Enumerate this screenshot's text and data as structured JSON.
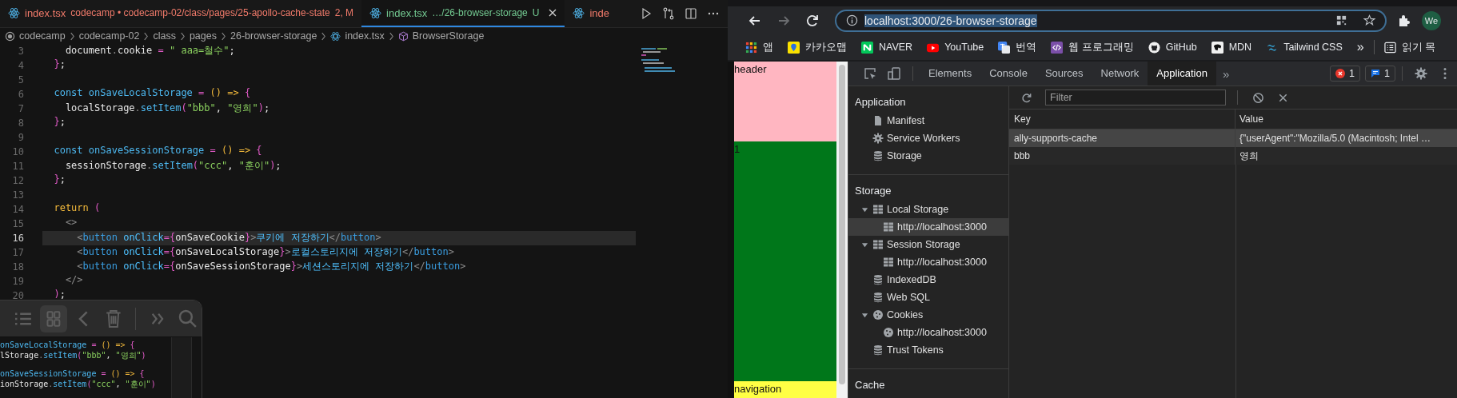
{
  "editor": {
    "tabs": [
      {
        "filename": "index.tsx",
        "path": "codecamp • codecamp-02/class/pages/25-apollo-cache-state",
        "status": "2, M",
        "kind": "modified",
        "selected": false
      },
      {
        "filename": "index.tsx",
        "path": "…/26-browser-storage",
        "status": "U",
        "kind": "untracked",
        "selected": true
      },
      {
        "filename": "inde",
        "kind": "modified",
        "selected": false
      }
    ],
    "breadcrumbs": [
      {
        "label": "codecamp",
        "kind": "folder"
      },
      {
        "label": "codecamp-02",
        "kind": "folder"
      },
      {
        "label": "class",
        "kind": "folder"
      },
      {
        "label": "pages",
        "kind": "folder"
      },
      {
        "label": "26-browser-storage",
        "kind": "folder"
      },
      {
        "label": "index.tsx",
        "kind": "file"
      },
      {
        "label": "BrowserStorage",
        "kind": "symbol"
      }
    ],
    "lines": [
      {
        "number": "3",
        "current": false,
        "tokens": [
          {
            "text": "    document",
            "kind": "plain"
          },
          {
            "text": ".",
            "kind": "punct"
          },
          {
            "text": "cookie ",
            "kind": "plain"
          },
          {
            "text": "= ",
            "kind": "op"
          },
          {
            "text": "\" aaa=철수\"",
            "kind": "str"
          },
          {
            "text": ";",
            "kind": "plain"
          }
        ]
      },
      {
        "number": "4",
        "current": false,
        "tokens": [
          {
            "text": "  }",
            "kind": "op"
          },
          {
            "text": ";",
            "kind": "plain"
          }
        ]
      },
      {
        "number": "5",
        "current": false
      },
      {
        "number": "6",
        "current": false,
        "tokens": [
          {
            "text": "  const ",
            "kind": "kw"
          },
          {
            "text": "onSaveLocalStorage ",
            "kind": "fn"
          },
          {
            "text": "= ",
            "kind": "op"
          },
          {
            "text": "() ",
            "kind": "yellow"
          },
          {
            "text": "=> ",
            "kind": "yellow"
          },
          {
            "text": "{",
            "kind": "op"
          }
        ]
      },
      {
        "number": "7",
        "current": false,
        "tokens": [
          {
            "text": "    localStorage",
            "kind": "plain"
          },
          {
            "text": ".",
            "kind": "punct"
          },
          {
            "text": "setItem",
            "kind": "fn"
          },
          {
            "text": "(",
            "kind": "op"
          },
          {
            "text": "\"bbb\"",
            "kind": "str"
          },
          {
            "text": ", ",
            "kind": "plain"
          },
          {
            "text": "\"영희\"",
            "kind": "str"
          },
          {
            "text": ")",
            "kind": "op"
          },
          {
            "text": ";",
            "kind": "plain"
          }
        ]
      },
      {
        "number": "8",
        "current": false,
        "tokens": [
          {
            "text": "  }",
            "kind": "op"
          },
          {
            "text": ";",
            "kind": "plain"
          }
        ]
      },
      {
        "number": "9",
        "current": false
      },
      {
        "number": "10",
        "current": false,
        "tokens": [
          {
            "text": "  const ",
            "kind": "kw"
          },
          {
            "text": "onSaveSessionStorage ",
            "kind": "fn"
          },
          {
            "text": "= ",
            "kind": "op"
          },
          {
            "text": "() ",
            "kind": "yellow"
          },
          {
            "text": "=> ",
            "kind": "yellow"
          },
          {
            "text": "{",
            "kind": "op"
          }
        ]
      },
      {
        "number": "11",
        "current": false,
        "tokens": [
          {
            "text": "    sessionStorage",
            "kind": "plain"
          },
          {
            "text": ".",
            "kind": "punct"
          },
          {
            "text": "setItem",
            "kind": "fn"
          },
          {
            "text": "(",
            "kind": "op"
          },
          {
            "text": "\"ccc\"",
            "kind": "str"
          },
          {
            "text": ", ",
            "kind": "plain"
          },
          {
            "text": "\"훈이\"",
            "kind": "str"
          },
          {
            "text": ")",
            "kind": "op"
          },
          {
            "text": ";",
            "kind": "plain"
          }
        ]
      },
      {
        "number": "12",
        "current": false,
        "tokens": [
          {
            "text": "  }",
            "kind": "op"
          },
          {
            "text": ";",
            "kind": "plain"
          }
        ]
      },
      {
        "number": "13",
        "current": false
      },
      {
        "number": "14",
        "current": false,
        "tokens": [
          {
            "text": "  return ",
            "kind": "yellow"
          },
          {
            "text": "(",
            "kind": "op"
          }
        ]
      },
      {
        "number": "15",
        "current": false,
        "tokens": [
          {
            "text": "    <>",
            "kind": "punct"
          }
        ]
      },
      {
        "number": "16",
        "current": true,
        "tokens": [
          {
            "text": "      <",
            "kind": "punct"
          },
          {
            "text": "button ",
            "kind": "tag"
          },
          {
            "text": "onClick",
            "kind": "attr"
          },
          {
            "text": "={",
            "kind": "op"
          },
          {
            "text": "onSaveCookie",
            "kind": "plain"
          },
          {
            "text": "}",
            "kind": "op"
          },
          {
            "text": ">",
            "kind": "punct"
          },
          {
            "text": "쿠키에 저장하기",
            "kind": "text"
          },
          {
            "text": "</",
            "kind": "punct"
          },
          {
            "text": "button",
            "kind": "tag"
          },
          {
            "text": ">",
            "kind": "punct"
          }
        ]
      },
      {
        "number": "17",
        "current": false,
        "tokens": [
          {
            "text": "      <",
            "kind": "punct"
          },
          {
            "text": "button ",
            "kind": "tag"
          },
          {
            "text": "onClick",
            "kind": "attr"
          },
          {
            "text": "={",
            "kind": "op"
          },
          {
            "text": "onSaveLocalStorage",
            "kind": "plain"
          },
          {
            "text": "}",
            "kind": "op"
          },
          {
            "text": ">",
            "kind": "punct"
          },
          {
            "text": "로컬스토리지에 저장하기",
            "kind": "text"
          },
          {
            "text": "</",
            "kind": "punct"
          },
          {
            "text": "button",
            "kind": "tag"
          },
          {
            "text": ">",
            "kind": "punct"
          }
        ]
      },
      {
        "number": "18",
        "current": false,
        "tokens": [
          {
            "text": "      <",
            "kind": "punct"
          },
          {
            "text": "button ",
            "kind": "tag"
          },
          {
            "text": "onClick",
            "kind": "attr"
          },
          {
            "text": "={",
            "kind": "op"
          },
          {
            "text": "onSaveSessionStorage",
            "kind": "plain"
          },
          {
            "text": "}",
            "kind": "op"
          },
          {
            "text": ">",
            "kind": "punct"
          },
          {
            "text": "세션스토리지에 저장하기",
            "kind": "text"
          },
          {
            "text": "</",
            "kind": "punct"
          },
          {
            "text": "button",
            "kind": "tag"
          },
          {
            "text": ">",
            "kind": "punct"
          }
        ]
      },
      {
        "number": "19",
        "current": false,
        "tokens": [
          {
            "text": "    </>",
            "kind": "punct"
          }
        ]
      },
      {
        "number": "20",
        "current": false,
        "tokens": [
          {
            "text": "  )",
            "kind": "op"
          },
          {
            "text": ";",
            "kind": "plain"
          }
        ]
      }
    ],
    "preview": {
      "view_modes": [
        {
          "selected": false
        },
        {
          "selected": true
        }
      ],
      "blocks": [
        {
          "lines": [
            {
              "tokens": [
                {
                  "text": "onSaveLocalStorage ",
                  "kind": "fn"
                },
                {
                  "text": "= ",
                  "kind": "op"
                },
                {
                  "text": "() => ",
                  "kind": "yellow"
                },
                {
                  "text": "{",
                  "kind": "op"
                }
              ]
            },
            {
              "tokens": [
                {
                  "text": "lStorage",
                  "kind": "plain"
                },
                {
                  "text": ".",
                  "kind": "punct"
                },
                {
                  "text": "setItem",
                  "kind": "fn"
                },
                {
                  "text": "(",
                  "kind": "op"
                },
                {
                  "text": "\"bbb\"",
                  "kind": "str"
                },
                {
                  "text": ", ",
                  "kind": "plain"
                },
                {
                  "text": "\"영희\"",
                  "kind": "str"
                },
                {
                  "text": ")",
                  "kind": "op"
                }
              ]
            }
          ]
        },
        {
          "lines": [
            {
              "tokens": [
                {
                  "text": "onSaveSessionStorage ",
                  "kind": "fn"
                },
                {
                  "text": "= ",
                  "kind": "op"
                },
                {
                  "text": "() => ",
                  "kind": "yellow"
                },
                {
                  "text": "{",
                  "kind": "op"
                }
              ]
            },
            {
              "tokens": [
                {
                  "text": "ionStorage",
                  "kind": "plain"
                },
                {
                  "text": ".",
                  "kind": "punct"
                },
                {
                  "text": "setItem",
                  "kind": "fn"
                },
                {
                  "text": "(",
                  "kind": "op"
                },
                {
                  "text": "\"ccc\"",
                  "kind": "str"
                },
                {
                  "text": ", ",
                  "kind": "plain"
                },
                {
                  "text": "\"훈이\"",
                  "kind": "str"
                },
                {
                  "text": ")",
                  "kind": "op"
                }
              ]
            }
          ]
        }
      ]
    }
  },
  "browser": {
    "forward_disabled": true,
    "address": {
      "url": "localhost:3000/26-browser-storage",
      "selected": true
    },
    "profile": "We",
    "bookmarks": [
      {
        "label": "앱",
        "kind": "apps"
      },
      {
        "label": "카카오맵",
        "kind": "map"
      },
      {
        "label": "NAVER",
        "kind": "naver"
      },
      {
        "label": "YouTube",
        "kind": "youtube"
      },
      {
        "label": "번역",
        "kind": "translate"
      },
      {
        "label": "웹 프로그래밍",
        "kind": "code"
      },
      {
        "label": "GitHub",
        "kind": "github"
      },
      {
        "label": "MDN",
        "kind": "mdn"
      },
      {
        "label": "Tailwind CSS",
        "kind": "tailwind"
      }
    ],
    "bookmarks_more": "»",
    "reading_list": "읽기 목",
    "page": [
      {
        "text": "header",
        "kind": "header",
        "color": "#ffb6c1"
      },
      {
        "text": "1",
        "kind": "main",
        "color": "#00771a"
      },
      {
        "text": "navigation",
        "kind": "nav",
        "color": "#ffff44"
      }
    ],
    "devtools": {
      "tabs": [
        {
          "label": "Elements",
          "selected": false
        },
        {
          "label": "Console",
          "selected": false
        },
        {
          "label": "Sources",
          "selected": false
        },
        {
          "label": "Network",
          "selected": false
        },
        {
          "label": "Application",
          "selected": true
        }
      ],
      "more_tabs": "»",
      "errors": "1",
      "messages": "1",
      "sidebar": [
        {
          "title": "Application",
          "items": [
            {
              "label": "Manifest",
              "kind": "file",
              "selected": false
            },
            {
              "label": "Service Workers",
              "kind": "gear",
              "selected": false
            },
            {
              "label": "Storage",
              "kind": "database",
              "selected": false
            }
          ]
        },
        {
          "title": "Storage",
          "items": [
            {
              "label": "Local Storage",
              "kind": "table",
              "selected": false,
              "expanded": true,
              "children": [
                {
                  "label": "http://localhost:3000",
                  "kind": "table",
                  "selected": true
                }
              ]
            },
            {
              "label": "Session Storage",
              "kind": "table",
              "selected": false,
              "expanded": true,
              "children": [
                {
                  "label": "http://localhost:3000",
                  "kind": "table",
                  "selected": false
                }
              ]
            },
            {
              "label": "IndexedDB",
              "kind": "database",
              "selected": false
            },
            {
              "label": "Web SQL",
              "kind": "database",
              "selected": false
            },
            {
              "label": "Cookies",
              "kind": "cookie",
              "selected": false,
              "expanded": true,
              "children": [
                {
                  "label": "http://localhost:3000",
                  "kind": "cookie",
                  "selected": false
                }
              ]
            },
            {
              "label": "Trust Tokens",
              "kind": "database",
              "selected": false
            }
          ]
        },
        {
          "title": "Cache"
        }
      ],
      "filter": {
        "placeholder": "Filter"
      },
      "columns": [
        "Key",
        "Value"
      ],
      "rows": [
        {
          "cells": [
            "ally-supports-cache",
            "{\"userAgent\":\"Mozilla/5.0 (Macintosh; Intel …"
          ],
          "selected": true
        },
        {
          "cells": [
            "bbb",
            "영희"
          ],
          "selected": false
        }
      ]
    }
  }
}
